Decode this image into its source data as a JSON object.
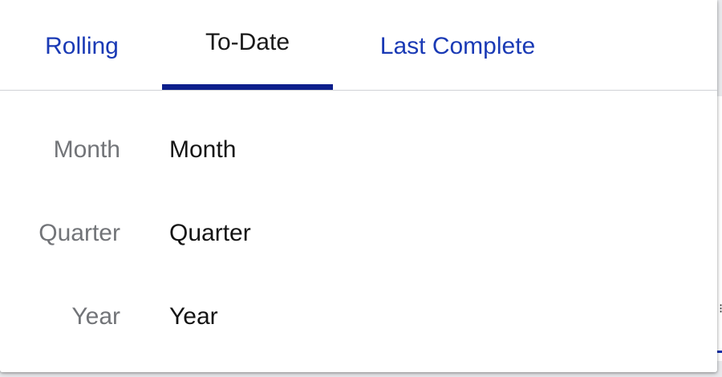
{
  "tabs": [
    {
      "label": "Rolling",
      "active": false
    },
    {
      "label": "To-Date",
      "active": true
    },
    {
      "label": "Last Complete",
      "active": false
    }
  ],
  "options": [
    {
      "label": "Month",
      "value": "Month"
    },
    {
      "label": "Quarter",
      "value": "Quarter"
    },
    {
      "label": "Year",
      "value": "Year"
    }
  ],
  "colors": {
    "link": "#1a3ab5",
    "active_indicator": "#0d1f8c",
    "label_gray": "#727478",
    "text": "#141414"
  }
}
